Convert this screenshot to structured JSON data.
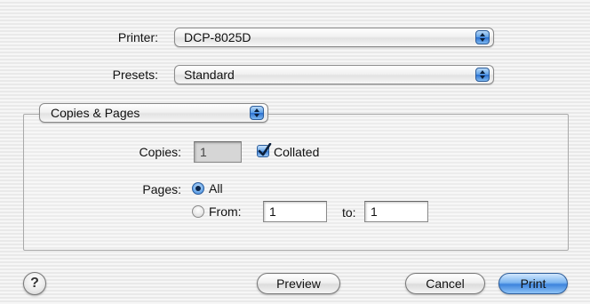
{
  "printer": {
    "label": "Printer:",
    "value": "DCP-8025D"
  },
  "presets": {
    "label": "Presets:",
    "value": "Standard"
  },
  "panel": {
    "value": "Copies & Pages"
  },
  "copies": {
    "label": "Copies:",
    "value": "1",
    "collated_label": "Collated",
    "collated_checked": true
  },
  "pages": {
    "label": "Pages:",
    "all_label": "All",
    "from_label": "From:",
    "from_value": "1",
    "to_label": "to:",
    "to_value": "1",
    "selected": "All"
  },
  "buttons": {
    "help": "?",
    "preview": "Preview",
    "cancel": "Cancel",
    "print": "Print"
  },
  "icons": {
    "popup_arrows": "up-down-arrows-icon",
    "checkmark": "checkmark-icon",
    "help": "question-mark-icon"
  },
  "colors": {
    "accent": "#3d84dd",
    "background": "#f0f0f0"
  }
}
